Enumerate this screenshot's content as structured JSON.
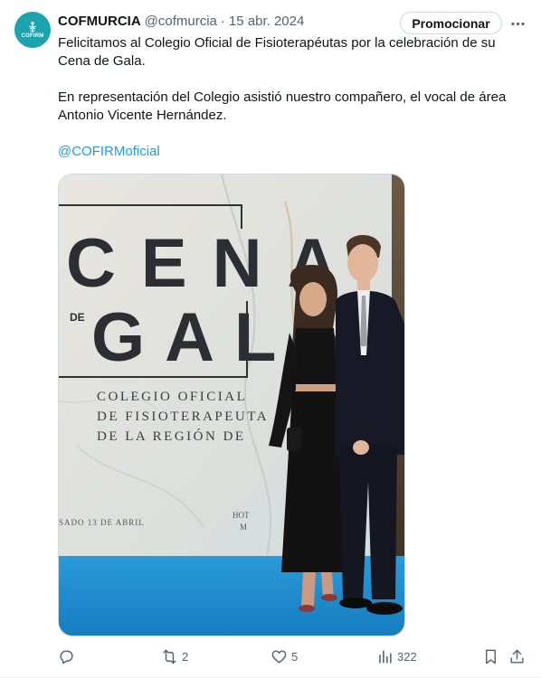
{
  "tweet": {
    "author": {
      "display_name": "COFMURCIA",
      "handle": "@cofmurcia",
      "avatar_text": "COFIRM",
      "avatar_icon": "caduceus-figure-icon",
      "avatar_color": "#1ba3b0"
    },
    "separator": "·",
    "date": "15 abr. 2024",
    "promote_label": "Promocionar",
    "more_icon": "more-horizontal-icon",
    "text": {
      "line1": "Felicitamos al Colegio Oficial de Fisioterapéutas por la celebración de su Cena de Gala.",
      "line2": "En representación del Colegio asistió nuestro compañero, el vocal de área Antonio Vicente Hernández.",
      "mention": "@COFIRMoficial"
    },
    "media": {
      "banner_line1": "CENA",
      "banner_de": "DE",
      "banner_line2": "GALA",
      "banner_sub1": "COLEGIO OFICIAL",
      "banner_sub2": "DE FISIOTERAPEUTA",
      "banner_sub3": "DE LA REGIÓN DE",
      "banner_date": "SADO 13 DE ABRIL",
      "banner_hotel1": "HOT",
      "banner_hotel2": "M"
    },
    "actions": {
      "reply": {
        "icon": "reply-icon",
        "count": ""
      },
      "retweet": {
        "icon": "retweet-icon",
        "count": "2"
      },
      "like": {
        "icon": "heart-icon",
        "count": "5"
      },
      "views": {
        "icon": "views-chart-icon",
        "count": "322"
      },
      "bookmark": {
        "icon": "bookmark-icon"
      },
      "share": {
        "icon": "share-icon"
      }
    },
    "colors": {
      "link": "#1d9bf0",
      "secondary_text": "#536471",
      "carpet_blue": "#1e8fd0"
    }
  }
}
